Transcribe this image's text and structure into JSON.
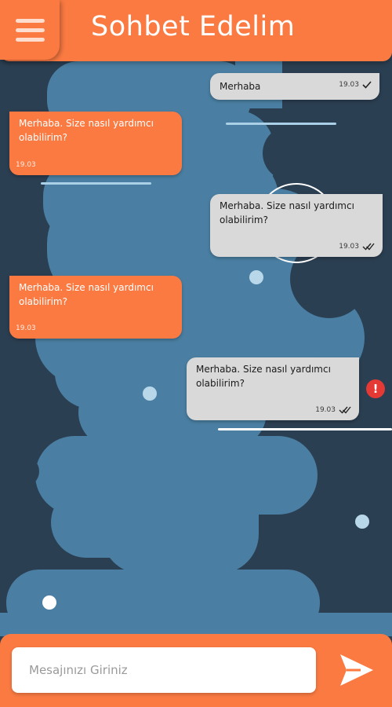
{
  "header": {
    "title": "Sohbet Edelim",
    "menu_icon": "hamburger-menu-icon"
  },
  "messages": [
    {
      "direction": "out",
      "text": "Merhaba",
      "time": "19.03",
      "status": "sent"
    },
    {
      "direction": "in",
      "text": "Merhaba. Size nasıl yardımcı olabilirim?",
      "time": "19.03"
    },
    {
      "direction": "out",
      "text": "Merhaba. Size nasıl yardımcı olabilirim?",
      "time": "19.03",
      "status": "read"
    },
    {
      "direction": "in",
      "text": "Merhaba. Size nasıl yardımcı olabilirim?",
      "time": "19.03"
    },
    {
      "direction": "out",
      "text": "Merhaba. Size nasıl yardımcı olabilirim?",
      "time": "19.03",
      "status": "read",
      "error": true
    }
  ],
  "error_icon": {
    "symbol": "!",
    "name": "error-icon"
  },
  "footer": {
    "input_placeholder": "Mesajınızı Giriniz",
    "send_icon": "send-icon"
  },
  "colors": {
    "accent": "#fa7a42",
    "background_dark": "#2b3f52",
    "background_light": "#4a7fa3",
    "bubble_out": "#d9d9d9",
    "error": "#e53935"
  }
}
